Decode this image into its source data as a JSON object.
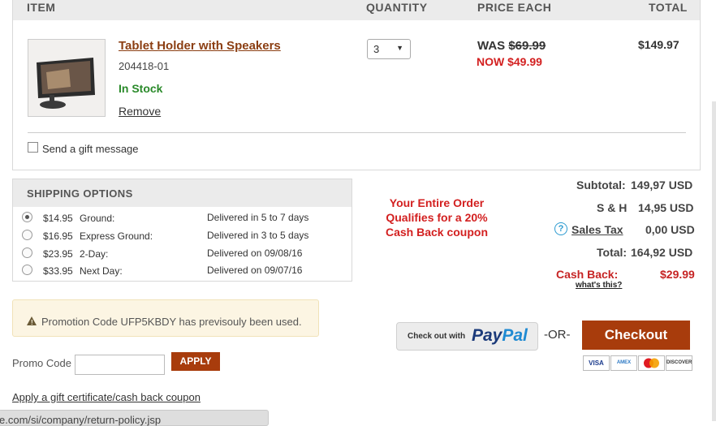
{
  "cart": {
    "headers": {
      "item": "ITEM",
      "quantity": "QUANTITY",
      "price_each": "PRICE EACH",
      "total": "TOTAL"
    },
    "item": {
      "name": "Tablet Holder with Speakers",
      "sku": "204418-01",
      "stock": "In Stock",
      "remove": "Remove",
      "quantity": "3",
      "was_label": "WAS",
      "was_price": "$69.99",
      "now_price": "NOW $49.99",
      "total": "$149.97"
    },
    "gift_message_label": "Send a gift message"
  },
  "shipping": {
    "title": "SHIPPING OPTIONS",
    "options": [
      {
        "price": "$14.95",
        "name": "Ground:",
        "delivery": "Delivered in 5 to 7 days",
        "selected": true
      },
      {
        "price": "$16.95",
        "name": "Express Ground:",
        "delivery": "Delivered in 3 to 5 days",
        "selected": false
      },
      {
        "price": "$23.95",
        "name": "2-Day:",
        "delivery": "Delivered on 09/08/16",
        "selected": false
      },
      {
        "price": "$33.95",
        "name": "Next Day:",
        "delivery": "Delivered on 09/07/16",
        "selected": false
      }
    ]
  },
  "cashback_promo": {
    "line1": "Your Entire Order",
    "line2": "Qualifies for a 20%",
    "line3": "Cash Back coupon"
  },
  "summary": {
    "subtotal_label": "Subtotal:",
    "subtotal": "149,97 USD",
    "sh_label": "S & H",
    "sh": "14,95 USD",
    "tax_label": "Sales Tax",
    "tax": "0,00 USD",
    "total_label": "Total:",
    "total": "164,92 USD",
    "cashback_label": "Cash Back:",
    "cashback": "$29.99",
    "whats_this": "what's this?"
  },
  "promo": {
    "warning": "Promotion Code UFP5KBDY has previsouly been used.",
    "label": "Promo Code",
    "value": "",
    "apply": "APPLY",
    "gift_cert_link": "Apply a gift certificate/cash back coupon"
  },
  "checkout": {
    "paypal_small": "Check out with",
    "paypal_pay": "Pay",
    "paypal_pal": "Pal",
    "or": "-OR-",
    "button": "Checkout",
    "cards": [
      "VISA",
      "AMEX",
      "MC",
      "DISCOVER"
    ]
  },
  "status_url": "e.com/si/company/return-policy.jsp",
  "colors": {
    "brand_button": "#a83c0c",
    "price_red": "#d32020",
    "stock_green": "#2a8a2a"
  }
}
